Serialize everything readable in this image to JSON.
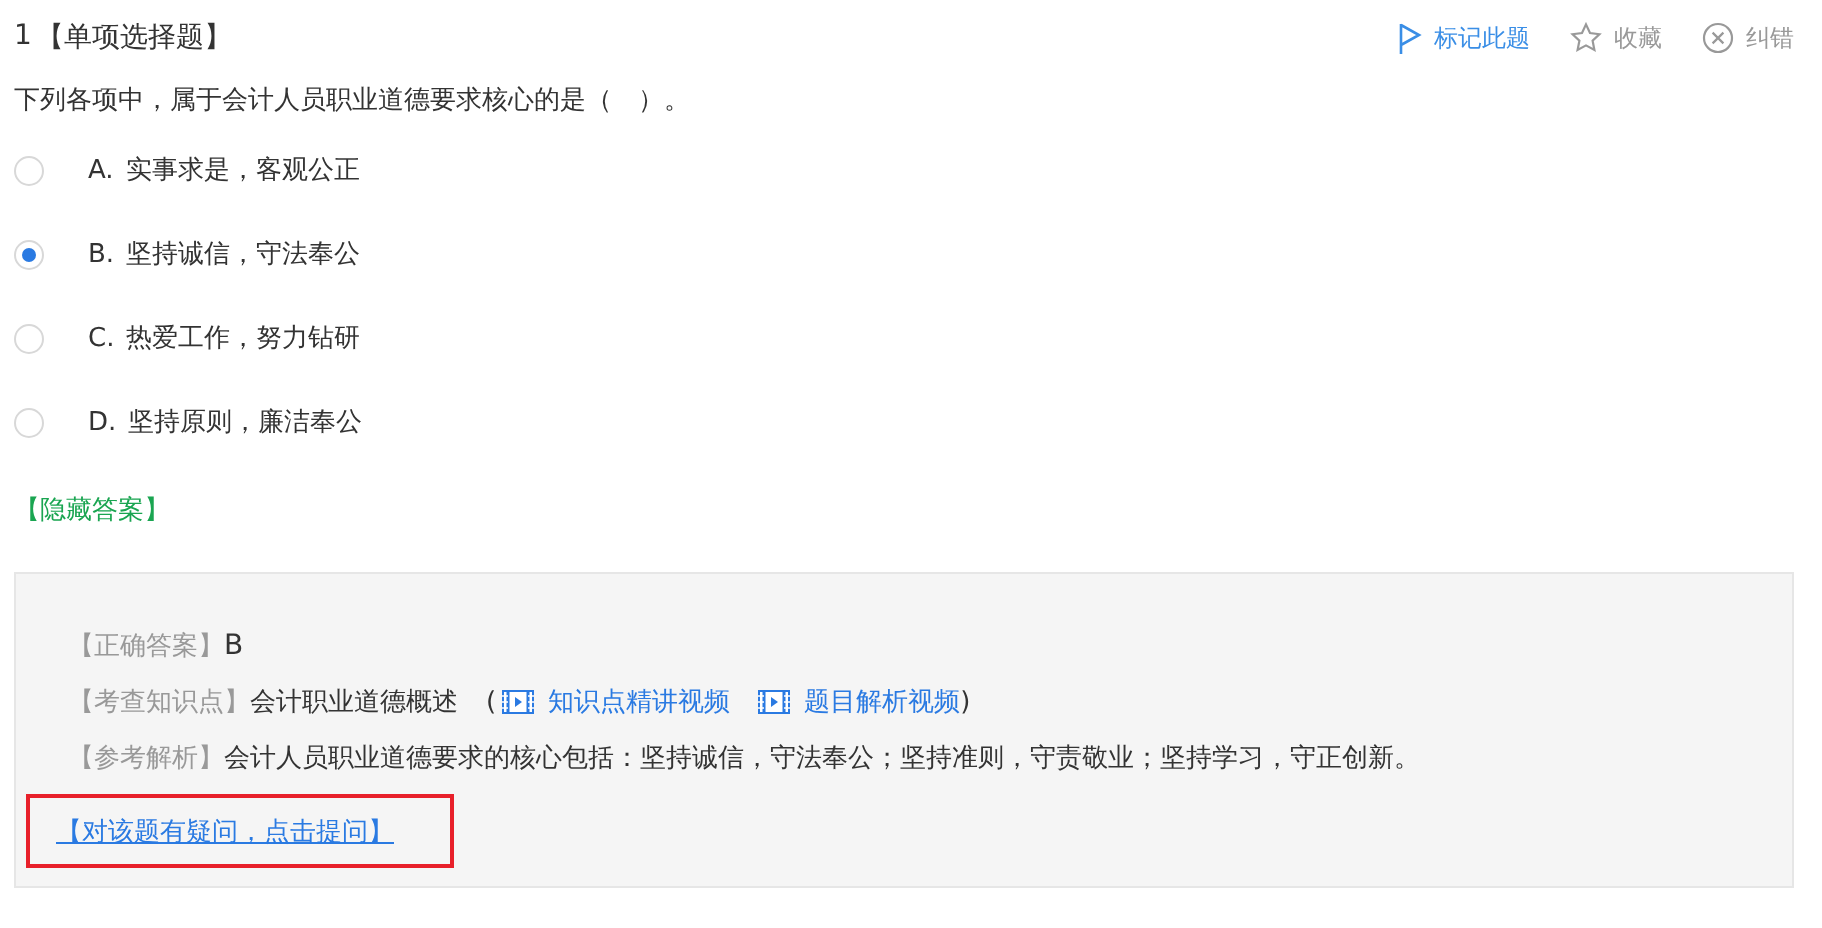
{
  "question": {
    "number": "1",
    "type": "【单项选择题】",
    "text": "下列各项中，属于会计人员职业道德要求核心的是（　）。"
  },
  "actions": [
    {
      "kind": "flag",
      "label": "标记此题"
    },
    {
      "kind": "star",
      "label": "收藏"
    },
    {
      "kind": "error",
      "label": "纠错"
    }
  ],
  "options": [
    {
      "letter": "A.",
      "text": "实事求是，客观公正",
      "selected": false
    },
    {
      "letter": "B.",
      "text": "坚持诚信，守法奉公",
      "selected": true
    },
    {
      "letter": "C.",
      "text": "热爱工作，努力钻研",
      "selected": false
    },
    {
      "letter": "D.",
      "text": "坚持原则，廉洁奉公",
      "selected": false
    }
  ],
  "toggle_answer": "【隐藏答案】",
  "answer_panel": {
    "correct": {
      "label": "【正确答案】",
      "value": "B"
    },
    "knowledge": {
      "label": "【考查知识点】",
      "value": "会计职业道德概述",
      "open": "(",
      "videos": [
        "知识点精讲视频",
        "题目解析视频"
      ],
      "close": ")"
    },
    "analysis": {
      "label": "【参考解析】",
      "value": "会计人员职业道德要求的核心包括：坚持诚信，守法奉公；坚持准则，守责敬业；坚持学习，守正创新。"
    },
    "ask": {
      "text": "【对该题有疑问，点击提问】",
      "highlighted": true
    }
  }
}
